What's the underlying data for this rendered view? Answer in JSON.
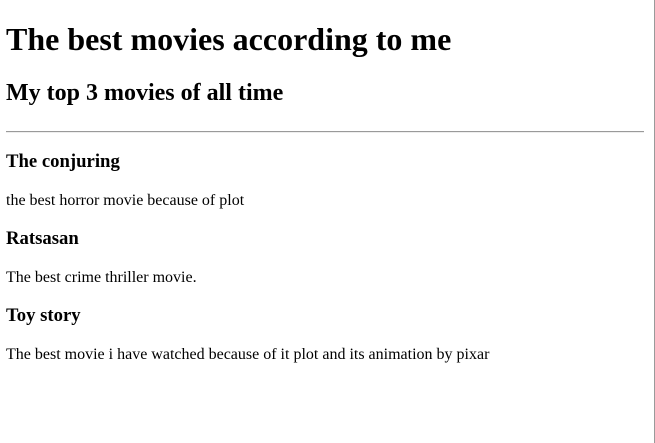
{
  "header": {
    "title": "The best movies according to me",
    "subtitle": "My top 3 movies of all time"
  },
  "movies": [
    {
      "title": "The conjuring",
      "description": "the best horror movie because of plot"
    },
    {
      "title": "Ratsasan",
      "description": "The best crime thriller movie."
    },
    {
      "title": "Toy story",
      "description": "The best movie i have watched because of it plot and its animation by pixar"
    }
  ]
}
